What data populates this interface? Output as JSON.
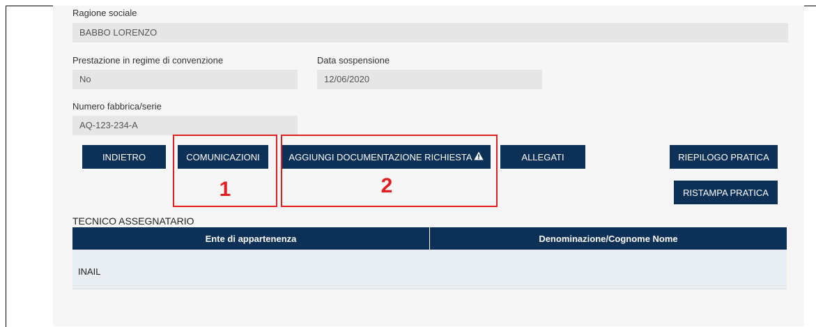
{
  "form": {
    "ragione_sociale_label": "Ragione sociale",
    "ragione_sociale_value": "BABBO LORENZO",
    "prestazione_label": "Prestazione in regime di convenzione",
    "prestazione_value": "No",
    "data_sospensione_label": "Data sospensione",
    "data_sospensione_value": "12/06/2020",
    "numero_fabbrica_label": "Numero fabbrica/serie",
    "numero_fabbrica_value": "AQ-123-234-A"
  },
  "buttons": {
    "indietro": "INDIETRO",
    "comunicazioni": "COMUNICAZIONI",
    "aggiungi_documentazione": "AGGIUNGI DOCUMENTAZIONE RICHIESTA",
    "allegati": "ALLEGATI",
    "riepilogo_pratica": "RIEPILOGO PRATICA",
    "ristampa_pratica": "RISTAMPA PRATICA"
  },
  "annotations": {
    "marker_1": "1",
    "marker_2": "2",
    "color": "#e02020"
  },
  "tecnico": {
    "section_title": "TECNICO ASSEGNATARIO",
    "columns": [
      "Ente di appartenenza",
      "Denominazione/Cognome Nome"
    ],
    "rows": [
      [
        "INAIL",
        ""
      ]
    ]
  },
  "colors": {
    "primary": "#0d3057",
    "field_bg": "#e6e6e6",
    "row_bg": "#e8edf2"
  },
  "icons": {
    "warning": "warning-triangle-icon"
  }
}
